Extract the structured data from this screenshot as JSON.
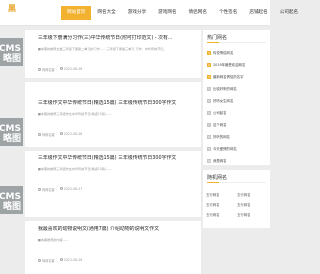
{
  "header": {
    "logo": "黑",
    "nav": [
      "网站首页",
      "网名大全",
      "游戏分享",
      "游戏网名",
      "情侣网名",
      "个性签名",
      "店铺起名",
      "公司起名"
    ]
  },
  "left_thumbs": [
    "ECMS\n略图",
    "ECMS\n略图",
    "ECMS\n略图"
  ],
  "articles": [
    {
      "title": "三年级下册满分习作(三)中华传统节日(附可打印范文) - 次有...",
      "desc": "■本期的推荐文章三年级下册第二单元的习作...... 三年级下册第三单元 习作：中华传统节日。",
      "author": "闷网名客",
      "date": "2023-06-28"
    },
    {
      "title": "三年级作文中华传统节日(精选15篇) 三年级传统节日300字作文",
      "desc": "■本期的推荐三年级作文中华传统节日(精选15篇)......",
      "author": "闷网名客",
      "date": "2023-06-28"
    },
    {
      "title": "三年级作文中华传统节日(精选15篇) 三年级传统节日300字作文",
      "desc": "■本期的推荐三年级作文中华传统节日(精选15篇)......",
      "author": "闷网名客",
      "date": "2023-06-27"
    },
    {
      "title": "我最喜欢的动物说明文(通用7篇) 介绍动物的说明文作文",
      "desc": "■本期推荐的内容......",
      "author": "闷网名客",
      "date": "2023-06-26"
    }
  ],
  "sidebar_hot": {
    "heading": "热门网名",
    "items": [
      "传说情侣网名",
      "2019年最受欢迎网名",
      "最新网名情侣的名字",
      "比较好听的网名",
      "好听女生网名",
      "公司起名",
      "这个网名",
      "好听的网名",
      "今天爱情的网名",
      "我是网名"
    ]
  },
  "sidebar_links": {
    "heading": "随机网名",
    "items": [
      "五行网名",
      "五行网名",
      "五行网名",
      "五行网名",
      "五行网名",
      "五行网名"
    ]
  },
  "colors": {
    "accent": "#f2b230",
    "thumb": "#9ea3a6"
  }
}
